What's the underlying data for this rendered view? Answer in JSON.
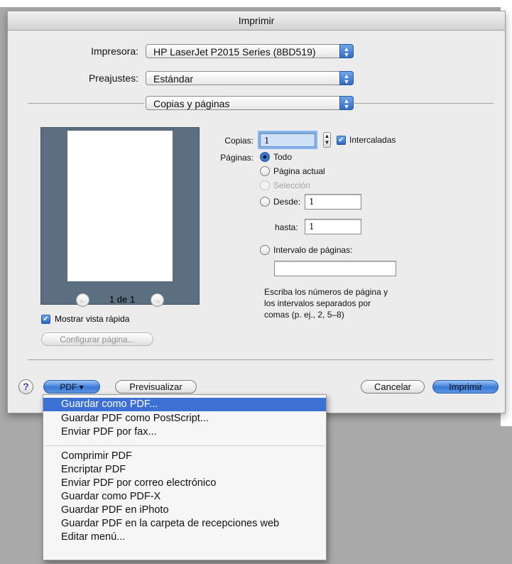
{
  "dialog": {
    "title": "Imprimir"
  },
  "printer": {
    "label": "Impresora:",
    "value": "HP LaserJet P2015 Series (8BD519)"
  },
  "presets": {
    "label": "Preajustes:",
    "value": "Estándar"
  },
  "panel": {
    "value": "Copias y páginas"
  },
  "preview": {
    "page_indicator": "1 de 1",
    "show_quick_preview_label": "Mostrar vista rápida",
    "show_quick_preview_checked": true,
    "page_setup_label": "Configurar página..."
  },
  "copies": {
    "label": "Copias:",
    "value": "1",
    "collated_label": "Intercaladas",
    "collated_checked": true
  },
  "pages": {
    "label": "Páginas:",
    "all_label": "Todo",
    "current_label": "Página actual",
    "selection_label": "Selección",
    "from_label": "Desde:",
    "from_value": "1",
    "to_label": "hasta:",
    "to_value": "1",
    "range_label": "Intervalo de páginas:",
    "range_value": "",
    "selected": "Todo",
    "hint_line1": "Escriba los números de página y",
    "hint_line2": "los intervalos separados por",
    "hint_line3": "comas (p. ej., 2, 5–8)"
  },
  "footer": {
    "help": "?",
    "pdf_label": "PDF ▾",
    "preview_label": "Previsualizar",
    "cancel_label": "Cancelar",
    "print_label": "Imprimir"
  },
  "pdf_menu": {
    "group1": [
      "Guardar como PDF...",
      "Guardar PDF como PostScript...",
      "Enviar PDF por fax..."
    ],
    "group2": [
      "Comprimir PDF",
      "Encriptar PDF",
      "Enviar PDF por correo electrónico",
      "Guardar como PDF-X",
      "Guardar PDF en iPhoto",
      "Guardar PDF en la carpeta de recepciones web",
      "Editar menú..."
    ],
    "highlighted": "Guardar como PDF..."
  },
  "colors": {
    "accent": "#3c70d2",
    "preview_frame": "#5c6f80",
    "dialog_bg": "#ececec"
  },
  "icons": {
    "popup": "up-down-arrows-icon",
    "back": "left-arrow-icon",
    "forward": "right-arrow-icon",
    "check": "checkmark-icon"
  }
}
